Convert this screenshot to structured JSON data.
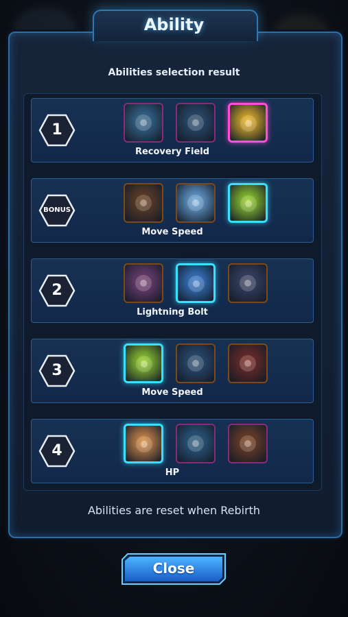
{
  "dialog": {
    "title": "Ability",
    "subtitle": "Abilities  selection result",
    "footer_note": "Abilities are reset when Rebirth",
    "close_label": "Close"
  },
  "rounds": [
    {
      "badge": "1",
      "selected_name": "Recovery Field",
      "abilities": [
        {
          "icon": "shockwave-icon",
          "frame": "purple",
          "selected": false,
          "color": "#3a6a8a"
        },
        {
          "icon": "energy-orb-icon",
          "frame": "purple",
          "selected": false,
          "color": "#2d4a66"
        },
        {
          "icon": "recovery-field-icon",
          "frame": "purple",
          "selected": true,
          "color": "#f2b619"
        }
      ]
    },
    {
      "badge": "BONUS",
      "selected_name": "Move Speed",
      "abilities": [
        {
          "icon": "meteor-icon",
          "frame": "orange",
          "selected": false,
          "color": "#6a3a14"
        },
        {
          "icon": "spirit-icon",
          "frame": "orange",
          "selected": false,
          "color": "#6fa8d8"
        },
        {
          "icon": "boot-icon",
          "frame": "orange",
          "selected": true,
          "color": "#9ad21e"
        }
      ]
    },
    {
      "badge": "2",
      "selected_name": "Lightning Bolt",
      "abilities": [
        {
          "icon": "portal-icon",
          "frame": "orange",
          "selected": false,
          "color": "#7a3a6a"
        },
        {
          "icon": "lightning-bolt-icon",
          "frame": "orange",
          "selected": true,
          "color": "#3a7ac8"
        },
        {
          "icon": "vortex-icon",
          "frame": "orange",
          "selected": false,
          "color": "#3a3f5a"
        }
      ]
    },
    {
      "badge": "3",
      "selected_name": "Move Speed",
      "abilities": [
        {
          "icon": "boot-icon",
          "frame": "orange",
          "selected": true,
          "color": "#9ad21e"
        },
        {
          "icon": "comet-icon",
          "frame": "orange",
          "selected": false,
          "color": "#2c4a6a"
        },
        {
          "icon": "demon-icon",
          "frame": "orange",
          "selected": false,
          "color": "#7a2414"
        }
      ]
    },
    {
      "badge": "4",
      "selected_name": "HP",
      "abilities": [
        {
          "icon": "strength-arm-icon",
          "frame": "orange",
          "selected": true,
          "color": "#e08a3a"
        },
        {
          "icon": "shield-dome-icon",
          "frame": "purple",
          "selected": false,
          "color": "#2c5a7a"
        },
        {
          "icon": "fireball-icon",
          "frame": "purple",
          "selected": false,
          "color": "#7a3a14"
        }
      ]
    }
  ]
}
